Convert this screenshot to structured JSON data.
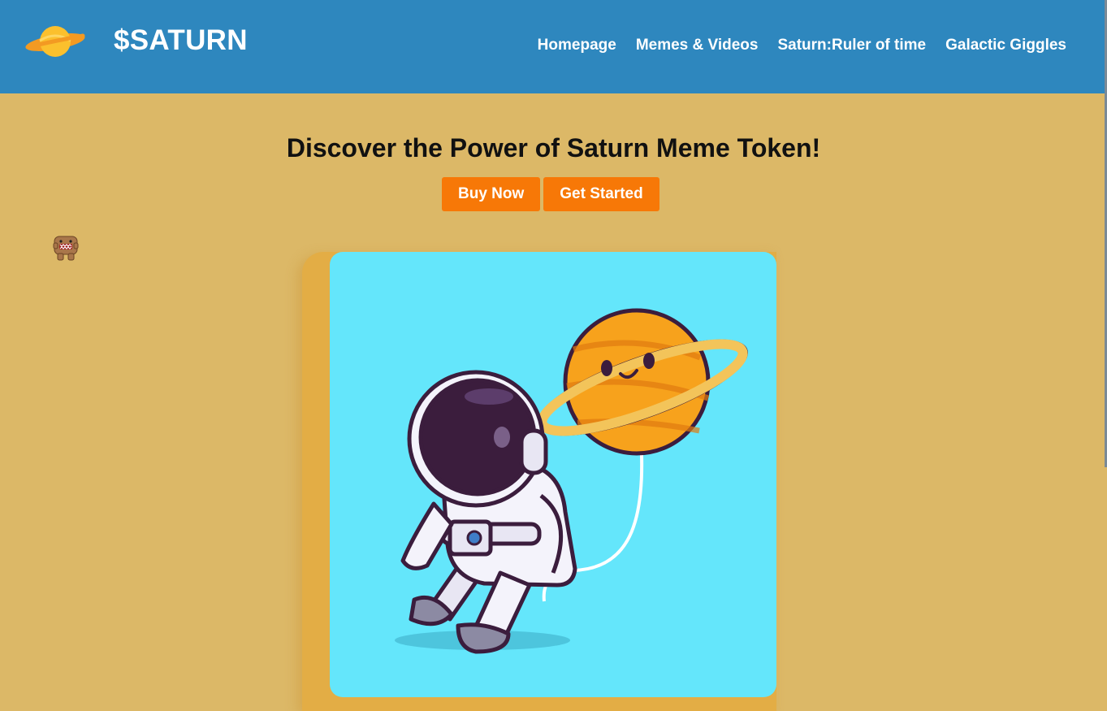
{
  "header": {
    "brand": "$SATURN",
    "logo_icon": "saturn-planet-icon",
    "nav": [
      "Homepage",
      "Memes & Videos",
      "Saturn:Ruler of time",
      "Galactic Giggles"
    ]
  },
  "hero": {
    "title": "Discover the Power of Saturn Meme Token!",
    "buttons": {
      "buy": "Buy Now",
      "start": "Get Started"
    }
  },
  "decor": {
    "mascot_icon": "domo-mascot-icon"
  },
  "illustration": {
    "subject": "astronaut-holding-saturn-balloon"
  },
  "colors": {
    "header_bg": "#2e87be",
    "page_bg": "#dcb867",
    "accent": "#f77807",
    "card_bg": "#64e6fb"
  }
}
